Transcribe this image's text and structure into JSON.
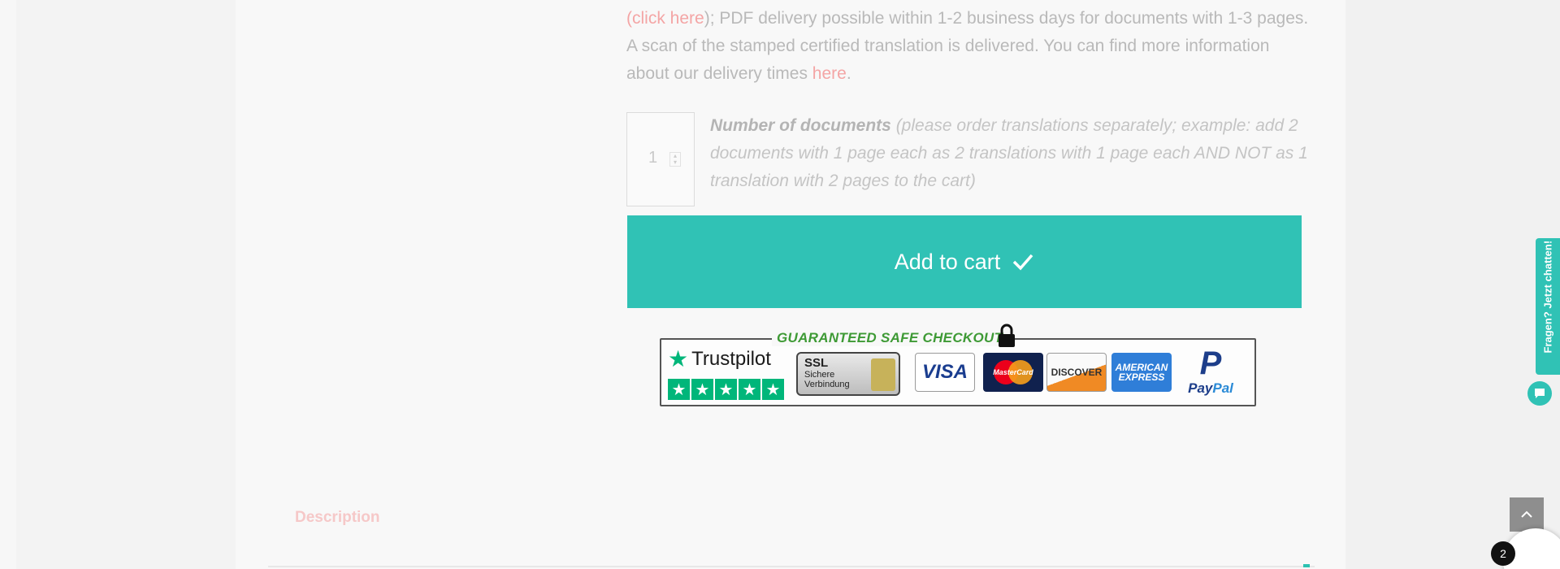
{
  "delivery": {
    "link_click_here": "(click here",
    "text_1": "); PDF delivery possible within 1-2 business days for documents with 1-3 pages. A scan of the stamped certified translation is delivered. You can find more information about our delivery times ",
    "link_here": "here",
    "text_2": "."
  },
  "quantity": {
    "value": "1"
  },
  "documents": {
    "label": "Number of documents",
    "hint": " (please order translations separately; example: add 2 documents with 1 page each as 2 translations with 1 page each AND NOT as 1 translation with 2 pages to the cart)"
  },
  "cart": {
    "button_label": "Add to cart"
  },
  "safe_checkout": {
    "title": "GUARANTEED SAFE CHECKOUT",
    "trustpilot": "Trustpilot",
    "ssl_title": "SSL",
    "ssl_subtitle_1": "Sichere",
    "ssl_subtitle_2": "Verbindung",
    "visa": "VISA",
    "mastercard": "MasterCard",
    "discover": "DISCOVER",
    "amex_1": "AMERICAN",
    "amex_2": "EXPRESS",
    "paypal_1": "Pay",
    "paypal_2": "Pal"
  },
  "tabs": {
    "description": "Description"
  },
  "chat": {
    "tab_label": "Fragen? Jetzt chatten!"
  },
  "widget": {
    "badge_count": "2"
  },
  "colors": {
    "accent": "#30c2b5",
    "link": "#f4a5a5",
    "trustpilot_green": "#00b67a"
  }
}
